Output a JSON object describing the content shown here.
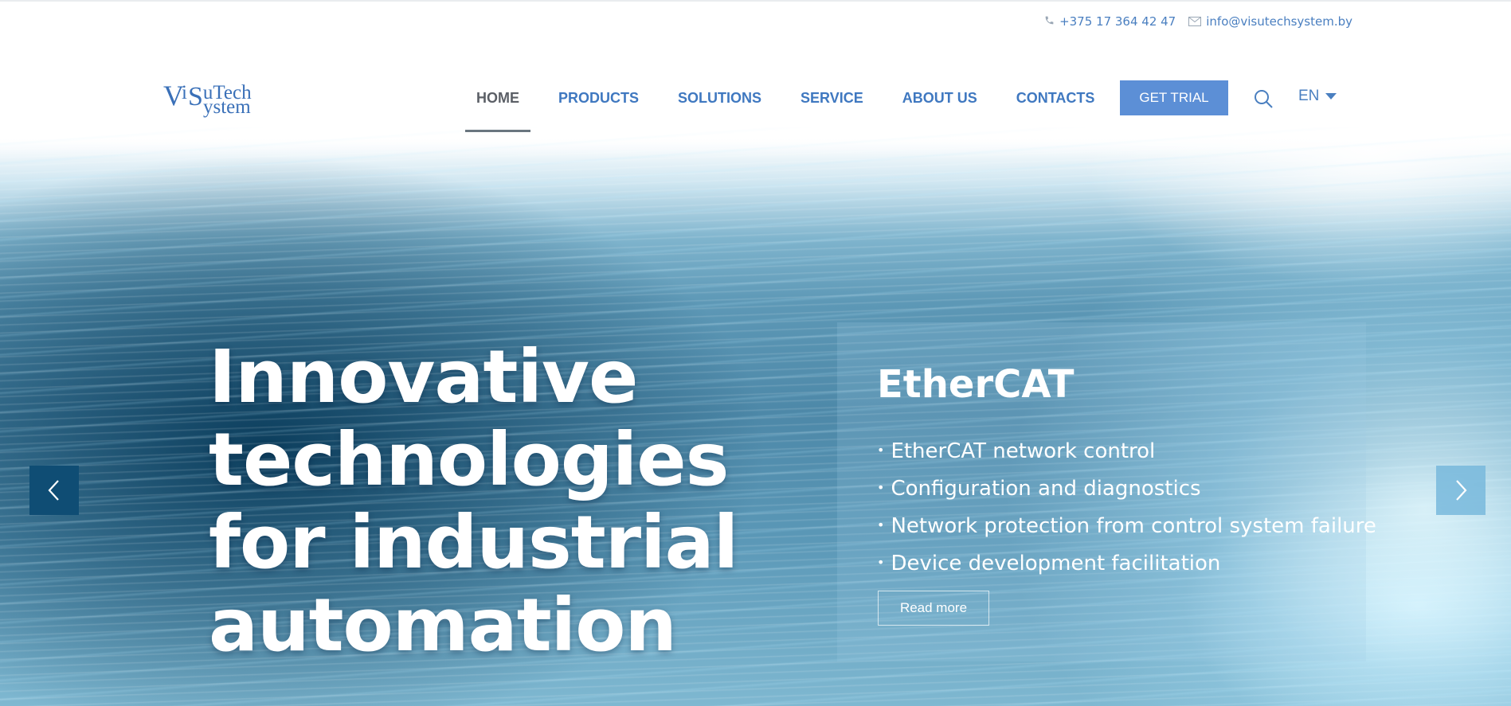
{
  "contact": {
    "phone": "+375 17 364 42 47",
    "email": "info@visutechsystem.by",
    "phone_icon": "phone-icon",
    "email_icon": "mail-icon"
  },
  "logo": {
    "line1": "ViSuTech",
    "line2": "System"
  },
  "nav": {
    "items": [
      {
        "label": "HOME",
        "active": true
      },
      {
        "label": "PRODUCTS",
        "active": false
      },
      {
        "label": "SOLUTIONS",
        "active": false
      },
      {
        "label": "SERVICE",
        "active": false
      },
      {
        "label": "ABOUT US",
        "active": false
      },
      {
        "label": "CONTACTS",
        "active": false
      }
    ],
    "trial_label": "GET TRIAL",
    "language": "EN",
    "search_icon": "search-icon"
  },
  "hero": {
    "headline": [
      "Innovative",
      "technologies",
      "for industrial",
      "automation"
    ],
    "panel": {
      "title": "EtherCAT",
      "bullets": [
        "EtherCAT network control",
        "Configuration and diagnostics",
        "Network protection from control system failure",
        "Device development facilitation"
      ],
      "button": "Read more"
    },
    "bullet_glyph": "•"
  },
  "colors": {
    "accent": "#5c8fd6",
    "nav_text": "#3f78c0",
    "active_text": "#5b5f66",
    "arrow_prev_bg": "#0f4d74",
    "arrow_next_bg": "#78b9dc"
  }
}
